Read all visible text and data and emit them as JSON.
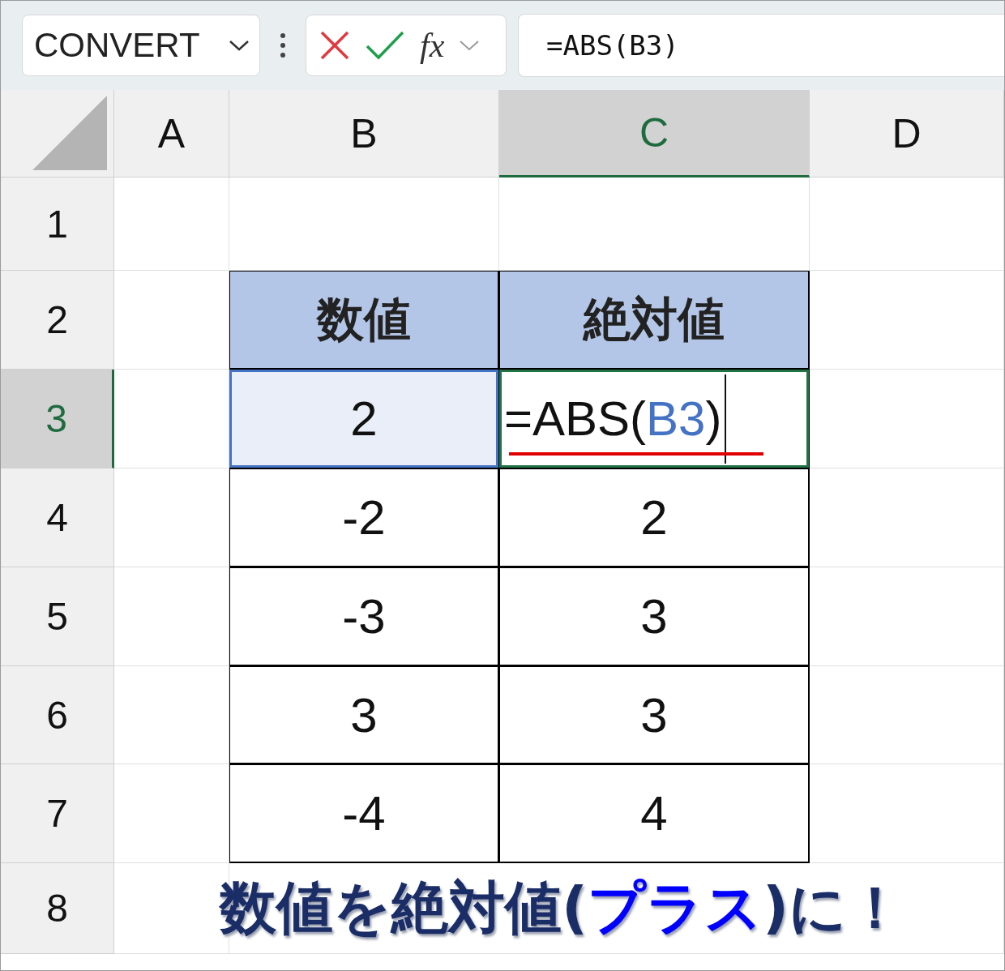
{
  "name_box": {
    "value": "CONVERT"
  },
  "formula_bar": {
    "fx": "fx",
    "value": "=ABS(B3)"
  },
  "columns": [
    {
      "label": "A",
      "selected": false
    },
    {
      "label": "B",
      "selected": false
    },
    {
      "label": "C",
      "selected": true
    },
    {
      "label": "D",
      "selected": false
    }
  ],
  "rows": [
    {
      "label": "1",
      "selected": false
    },
    {
      "label": "2",
      "selected": false
    },
    {
      "label": "3",
      "selected": true
    },
    {
      "label": "4",
      "selected": false
    },
    {
      "label": "5",
      "selected": false
    },
    {
      "label": "6",
      "selected": false
    },
    {
      "label": "7",
      "selected": false
    },
    {
      "label": "8",
      "selected": false
    }
  ],
  "table": {
    "headers": [
      "数値",
      "絶対値"
    ],
    "rows": [
      {
        "cells": [
          {
            "kind": "reference",
            "text": "2"
          },
          {
            "kind": "formula",
            "parts": [
              {
                "kind": "plain",
                "text": "=ABS("
              },
              {
                "kind": "ref",
                "text": "B3"
              },
              {
                "kind": "plain",
                "text": ")"
              }
            ]
          }
        ]
      },
      {
        "cells": [
          {
            "kind": "value",
            "text": "-2"
          },
          {
            "kind": "value",
            "text": "2"
          }
        ]
      },
      {
        "cells": [
          {
            "kind": "value",
            "text": "-3"
          },
          {
            "kind": "value",
            "text": "3"
          }
        ]
      },
      {
        "cells": [
          {
            "kind": "value",
            "text": "3"
          },
          {
            "kind": "value",
            "text": "3"
          }
        ]
      },
      {
        "cells": [
          {
            "kind": "value",
            "text": "-4"
          },
          {
            "kind": "value",
            "text": "4"
          }
        ]
      }
    ]
  },
  "caption": [
    {
      "kind": "plain",
      "text": "数値を絶対値("
    },
    {
      "kind": "accent",
      "text": "プラス"
    },
    {
      "kind": "plain",
      "text": ")に！"
    }
  ]
}
